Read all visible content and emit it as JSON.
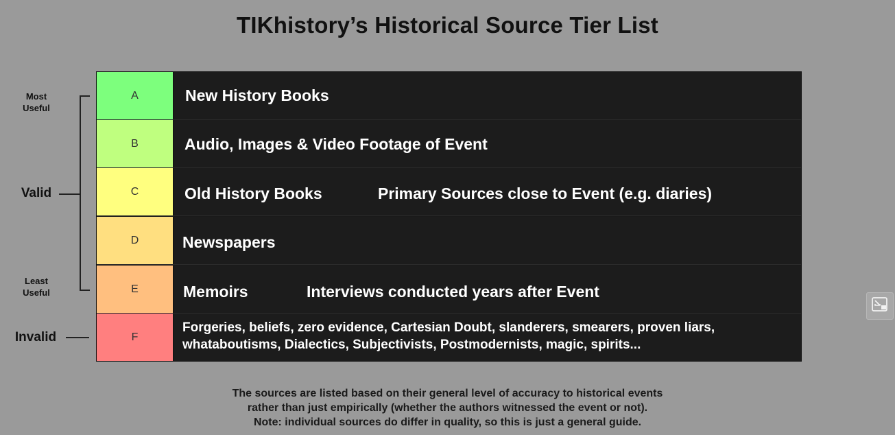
{
  "title": "TIKhistory’s Historical Source Tier List",
  "side_labels": {
    "most_useful": "Most\nUseful",
    "least_useful": "Least\nUseful",
    "valid": "Valid",
    "invalid": "Invalid"
  },
  "tiers": [
    {
      "label": "A",
      "color": "#7dff7d",
      "items": [
        "New History Books"
      ]
    },
    {
      "label": "B",
      "color": "#bfff7f",
      "items": [
        "Audio, Images & Video Footage of Event"
      ]
    },
    {
      "label": "C",
      "color": "#ffff7f",
      "items": [
        "Old History Books",
        "Primary Sources close to Event (e.g. diaries)"
      ]
    },
    {
      "label": "D",
      "color": "#ffdf80",
      "items": [
        "Newspapers"
      ]
    },
    {
      "label": "E",
      "color": "#ffbf7f",
      "items": [
        "Memoirs",
        "Interviews conducted years after Event"
      ]
    },
    {
      "label": "F",
      "color": "#ff7f7f",
      "items": [
        "Forgeries, beliefs, zero evidence, Cartesian Doubt, slanderers, smearers, proven liars, whataboutisms, Dialectics, Subjectivists, Postmodernists, magic, spirits..."
      ]
    }
  ],
  "footnote": {
    "line1": "The sources are listed based on their general level of accuracy to historical events",
    "line2": "rather than just empirically (whether the authors witnessed the event or not).",
    "line3": "Note: individual sources do differ in quality, so this is just a general guide."
  },
  "float_button": {
    "icon": "picture-in-picture-exit-icon"
  }
}
